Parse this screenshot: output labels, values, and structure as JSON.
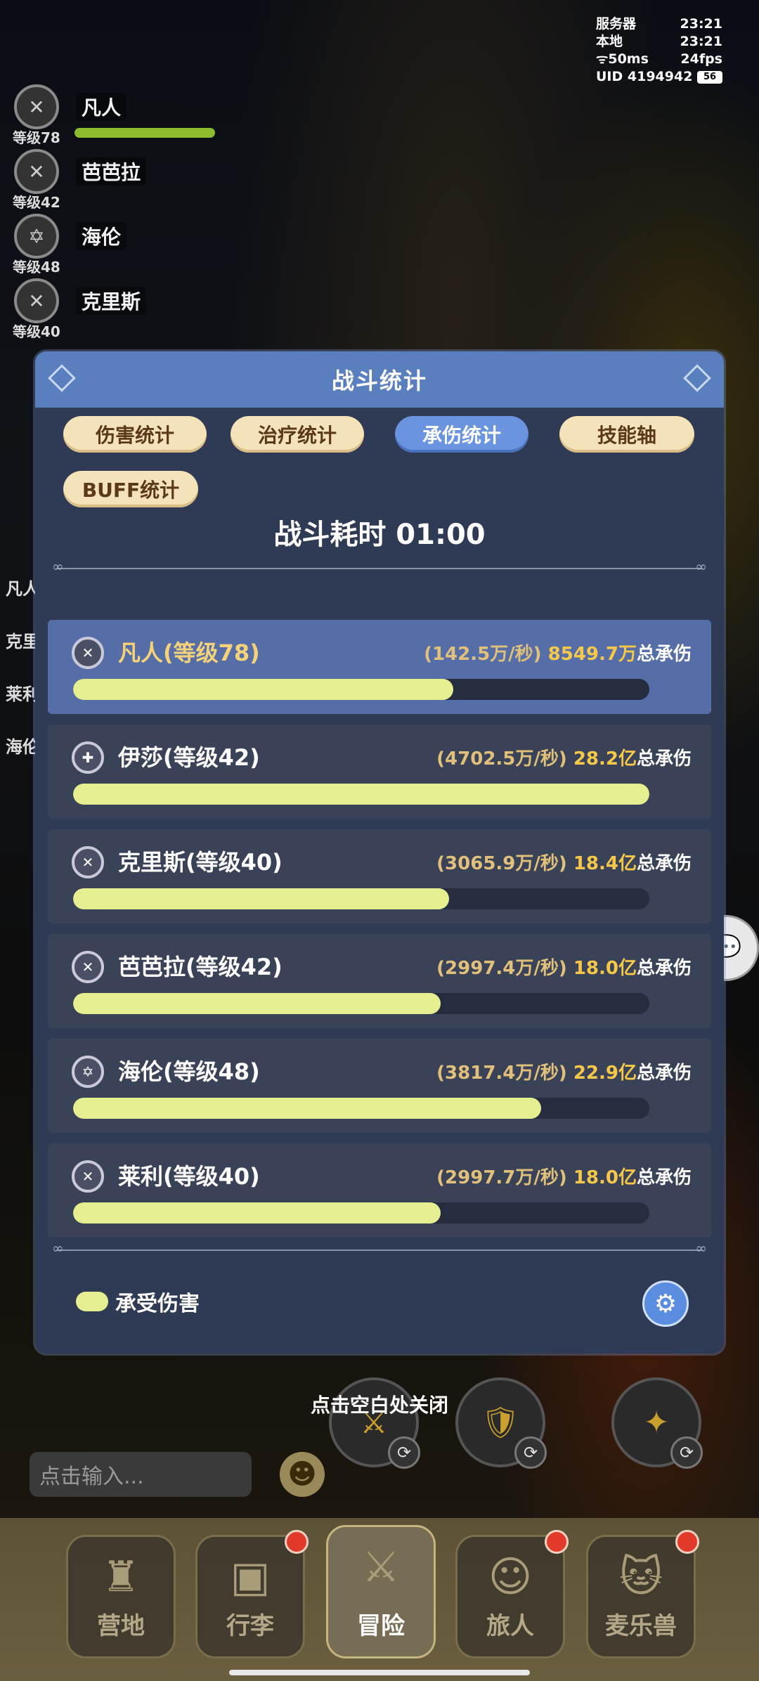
{
  "status": {
    "server_label": "服务器",
    "server_time": "23:21",
    "local_label": "本地",
    "local_time": "23:21",
    "ping": "50ms",
    "fps": "24fps",
    "uid": "UID 4194942",
    "battery": "56"
  },
  "party": [
    {
      "name": "凡人",
      "level": "等级78"
    },
    {
      "name": "芭芭拉",
      "level": "等级42"
    },
    {
      "name": "海伦",
      "level": "等级48"
    },
    {
      "name": "克里斯",
      "level": "等级40"
    }
  ],
  "side_labels": [
    "凡人",
    "克里",
    "莱利",
    "海伦"
  ],
  "modal": {
    "title": "战斗统计",
    "tabs": [
      {
        "label": "伤害统计",
        "active": false
      },
      {
        "label": "治疗统计",
        "active": false
      },
      {
        "label": "承伤统计",
        "active": true
      },
      {
        "label": "技能轴",
        "active": false
      },
      {
        "label": "BUFF统计",
        "active": false
      }
    ],
    "duration_label": "战斗耗时",
    "duration_value": "01:00",
    "legend": "承受伤害"
  },
  "chart_data": {
    "type": "bar",
    "series_name": "承受伤害",
    "max_total_yi": 28.2,
    "rows": [
      {
        "name": "凡人(等级78)",
        "rate": "(142.5万/秒)",
        "total": "8549.7万",
        "total_label": "总承伤",
        "fill": 0.66,
        "highlight": true,
        "icon": "✕"
      },
      {
        "name": "伊莎(等级42)",
        "rate": "(4702.5万/秒)",
        "total": "28.2亿",
        "total_label": "总承伤",
        "fill": 1.0,
        "highlight": false,
        "icon": "✚"
      },
      {
        "name": "克里斯(等级40)",
        "rate": "(3065.9万/秒)",
        "total": "18.4亿",
        "total_label": "总承伤",
        "fill": 0.652,
        "highlight": false,
        "icon": "✕"
      },
      {
        "name": "芭芭拉(等级42)",
        "rate": "(2997.4万/秒)",
        "total": "18.0亿",
        "total_label": "总承伤",
        "fill": 0.638,
        "highlight": false,
        "icon": "✕"
      },
      {
        "name": "海伦(等级48)",
        "rate": "(3817.4万/秒)",
        "total": "22.9亿",
        "total_label": "总承伤",
        "fill": 0.812,
        "highlight": false,
        "icon": "✡"
      },
      {
        "name": "莱利(等级40)",
        "rate": "(2997.7万/秒)",
        "total": "18.0亿",
        "total_label": "总承伤",
        "fill": 0.638,
        "highlight": false,
        "icon": "✕"
      }
    ]
  },
  "close_hint": "点击空白处关闭",
  "chat": {
    "placeholder": "点击输入..."
  },
  "nav": [
    {
      "label": "营地",
      "active": false,
      "badge": false
    },
    {
      "label": "行李",
      "active": false,
      "badge": true
    },
    {
      "label": "冒险",
      "active": true,
      "badge": false
    },
    {
      "label": "旅人",
      "active": false,
      "badge": true
    },
    {
      "label": "麦乐兽",
      "active": false,
      "badge": true
    }
  ]
}
